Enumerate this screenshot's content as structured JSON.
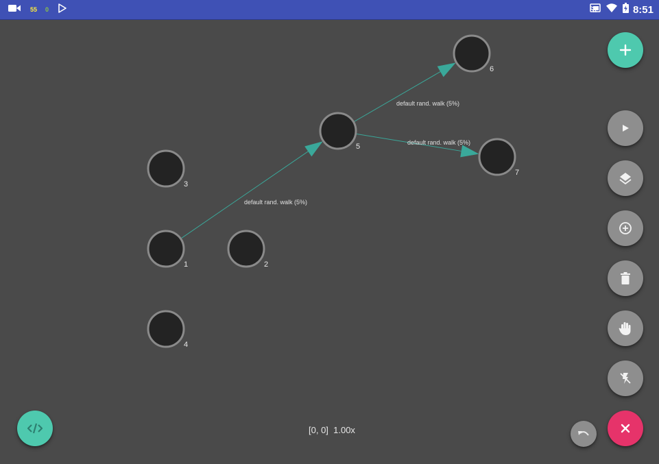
{
  "status_bar": {
    "left_icons": [
      "video-camera-icon",
      "play-store-icon"
    ],
    "count_1": "55",
    "count_2": "0",
    "right_icons": [
      "cast-icon",
      "wifi-icon",
      "battery-charging-icon"
    ],
    "time": "8:51"
  },
  "graph": {
    "nodes": [
      {
        "id": "1",
        "label": "1"
      },
      {
        "id": "2",
        "label": "2"
      },
      {
        "id": "3",
        "label": "3"
      },
      {
        "id": "4",
        "label": "4"
      },
      {
        "id": "5",
        "label": "5"
      },
      {
        "id": "6",
        "label": "6"
      },
      {
        "id": "7",
        "label": "7"
      }
    ],
    "edges": [
      {
        "from": "1",
        "to": "5",
        "label": "default rand. walk (5%)"
      },
      {
        "from": "5",
        "to": "6",
        "label": "default rand. walk (5%)"
      },
      {
        "from": "5",
        "to": "7",
        "label": "default rand. walk (5%)"
      }
    ],
    "colors": {
      "canvas": "#4a4a4a",
      "node_fill": "#232323",
      "node_ring": "#8a8a8a",
      "edge": "#3aa89a"
    }
  },
  "toolbar": {
    "buttons": [
      {
        "name": "add-node-button",
        "icon": "plus-icon"
      },
      {
        "name": "play-button",
        "icon": "play-icon"
      },
      {
        "name": "layers-button",
        "icon": "layers-icon"
      },
      {
        "name": "add-circle-button",
        "icon": "add-circle-icon"
      },
      {
        "name": "delete-button",
        "icon": "trash-icon"
      },
      {
        "name": "pan-button",
        "icon": "hand-icon"
      },
      {
        "name": "flash-off-button",
        "icon": "flash-off-icon"
      },
      {
        "name": "close-button",
        "icon": "close-icon"
      }
    ],
    "code_button_icon": "code-icon",
    "undo_button_icon": "undo-icon",
    "accent_teal": "#4ec9ae",
    "accent_pink": "#e6336a"
  },
  "viewport": {
    "readout": "[0, 0]  1.00x"
  }
}
